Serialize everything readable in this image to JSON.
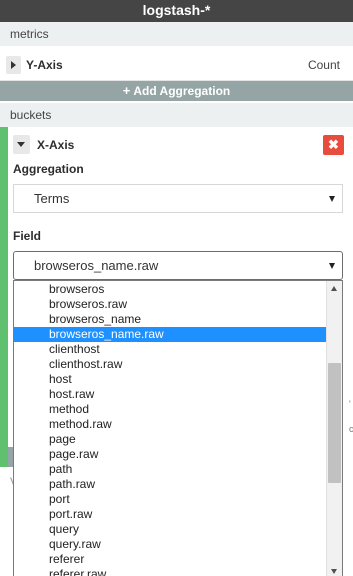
{
  "header": {
    "title": "logstash-*"
  },
  "metrics": {
    "section_label": "metrics",
    "y_axis": {
      "label": "Y-Axis",
      "value": "Count"
    }
  },
  "add_aggregation": {
    "label": "Add Aggregation"
  },
  "buckets": {
    "section_label": "buckets",
    "x_axis": {
      "label": "X-Axis",
      "remove_symbol": "✖",
      "aggregation_label": "Aggregation",
      "aggregation_value": "Terms",
      "field_label": "Field",
      "field_value": "browseros_name.raw"
    }
  },
  "field_dropdown": {
    "options": [
      "browseros",
      "browseros.raw",
      "browseros_name",
      "browseros_name.raw",
      "clienthost",
      "clienthost.raw",
      "host",
      "host.raw",
      "method",
      "method.raw",
      "page",
      "page.raw",
      "path",
      "path.raw",
      "port",
      "port.raw",
      "query",
      "query.raw",
      "referer",
      "referer.raw"
    ],
    "selected_index": 3
  },
  "background_letter": "V",
  "colors": {
    "title_bar": "#454545",
    "accent_green": "#5fc16f",
    "add_bar": "#95a5a6",
    "danger": "#e74c3c",
    "selection": "#1e90ff"
  }
}
